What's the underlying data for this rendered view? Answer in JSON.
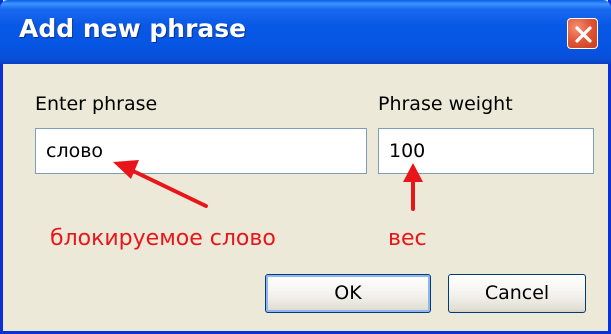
{
  "dialog": {
    "title": "Add new phrase",
    "close_icon": "close-icon"
  },
  "form": {
    "phrase_label": "Enter phrase",
    "phrase_value": "слово",
    "weight_label": "Phrase weight",
    "weight_value": "100"
  },
  "annotations": {
    "phrase_note": "блокируемое слово",
    "weight_note": "вес",
    "color": "#e8161b"
  },
  "buttons": {
    "ok_label": "OK",
    "cancel_label": "Cancel"
  },
  "colors": {
    "titlebar": "#0858e6",
    "window_bg": "#ece9d8",
    "close_button": "#e2583a"
  }
}
